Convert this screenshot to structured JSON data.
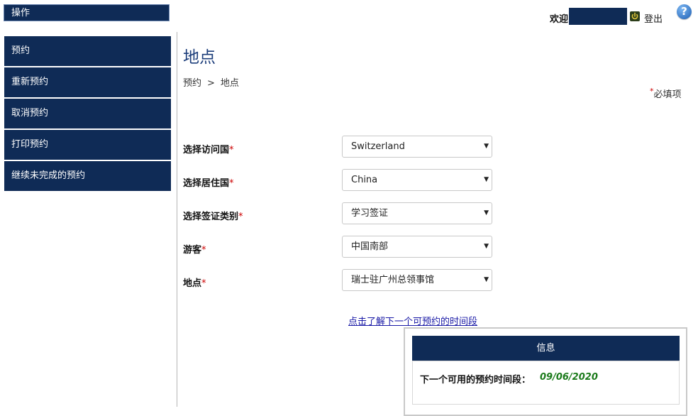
{
  "sidebar": {
    "header": "操作",
    "items": [
      {
        "label": "预约"
      },
      {
        "label": "重新预约"
      },
      {
        "label": "取消预约"
      },
      {
        "label": "打印预约"
      },
      {
        "label": "继续未完成的预约"
      }
    ]
  },
  "topbar": {
    "welcome": "欢迎",
    "logout": "登出",
    "help_icon": "?"
  },
  "main": {
    "title": "地点",
    "breadcrumb": {
      "parent": "预约",
      "separator": ">",
      "current": "地点"
    },
    "required_star": "*",
    "required_note": "必填项",
    "form": [
      {
        "label": "选择访问国",
        "value": "Switzerland"
      },
      {
        "label": "选择居住国",
        "value": "China"
      },
      {
        "label": "选择签证类别",
        "value": "学习签证"
      },
      {
        "label": "游客",
        "value": "中国南部"
      },
      {
        "label": "地点",
        "value": "瑞士驻广州总领事馆"
      }
    ],
    "next_link": "点击了解下一个可预约的时间段",
    "info": {
      "header": "信息",
      "label": "下一个可用的预约时间段：",
      "date": "09/06/2020"
    }
  },
  "colors": {
    "navy": "#0f2b56",
    "required": "#cc0000",
    "date_green": "#1a7a1a"
  },
  "icons": [
    "power-icon",
    "help-icon",
    "dropdown-arrow-icon"
  ]
}
